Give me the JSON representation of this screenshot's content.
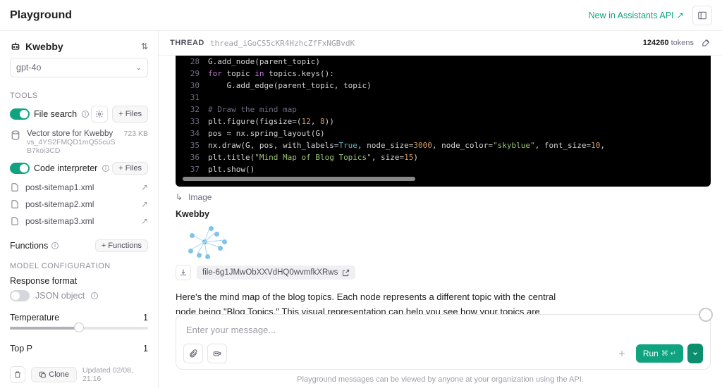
{
  "topbar": {
    "title": "Playground",
    "api_link": "New in Assistants API"
  },
  "sidebar": {
    "assistant_name": "Kwebby",
    "model": "gpt-4o",
    "tools_header": "TOOLS",
    "file_search": {
      "label": "File search",
      "files_btn": "+  Files"
    },
    "vector_store": {
      "title": "Vector store for Kwebby",
      "id": "vs_4YS2FMQD1mQ55cuSB7koi3CD",
      "size": "723 KB"
    },
    "code_interpreter": {
      "label": "Code interpreter",
      "files_btn": "+  Files"
    },
    "files": [
      {
        "name": "post-sitemap1.xml"
      },
      {
        "name": "post-sitemap2.xml"
      },
      {
        "name": "post-sitemap3.xml"
      }
    ],
    "functions": {
      "label": "Functions",
      "add_btn": "+  Functions"
    },
    "model_cfg_header": "MODEL CONFIGURATION",
    "response_format": {
      "label": "Response format",
      "json_label": "JSON object"
    },
    "temperature": {
      "label": "Temperature",
      "value": "1"
    },
    "top_p": {
      "label": "Top P",
      "value": "1"
    },
    "footer": {
      "clone": "Clone",
      "updated": "Updated 02/08, 21:16"
    }
  },
  "thread": {
    "label": "THREAD",
    "id": "thread_iGoCS5cKR4HzhcZfFxNGBvdK",
    "tokens_count": "124260",
    "tokens_label": "tokens"
  },
  "code": {
    "lines": [
      {
        "n": "28",
        "raw": "G.add_node(parent_topic)"
      },
      {
        "n": "29",
        "raw": "for topic in topics.keys():"
      },
      {
        "n": "30",
        "raw": "    G.add_edge(parent_topic, topic)"
      },
      {
        "n": "31",
        "raw": ""
      },
      {
        "n": "32",
        "raw": "# Draw the mind map"
      },
      {
        "n": "33",
        "raw": "plt.figure(figsize=(12, 8))"
      },
      {
        "n": "34",
        "raw": "pos = nx.spring_layout(G)"
      },
      {
        "n": "35",
        "raw": "nx.draw(G, pos, with_labels=True, node_size=3000, node_color=\"skyblue\", font_size=10,"
      },
      {
        "n": "36",
        "raw": "plt.title(\"Mind Map of Blog Topics\", size=15)"
      },
      {
        "n": "37",
        "raw": "plt.show()"
      }
    ]
  },
  "output": {
    "image_label": "Image",
    "assistant": "Kwebby",
    "file_id": "file-6g1JMwObXXVdHQ0wvmfkXRws",
    "reply": "Here's the mind map of the blog topics. Each node represents a different topic with the central node being \"Blog Topics.\" This visual representation can help you see how your topics are distributed and interlinked. If you need any further details or modifications, feel free to ask!"
  },
  "composer": {
    "placeholder": "Enter your message...",
    "run": "Run",
    "shortcut": "⌘ ↵"
  },
  "footer_note": "Playground messages can be viewed by anyone at your organization using the API."
}
